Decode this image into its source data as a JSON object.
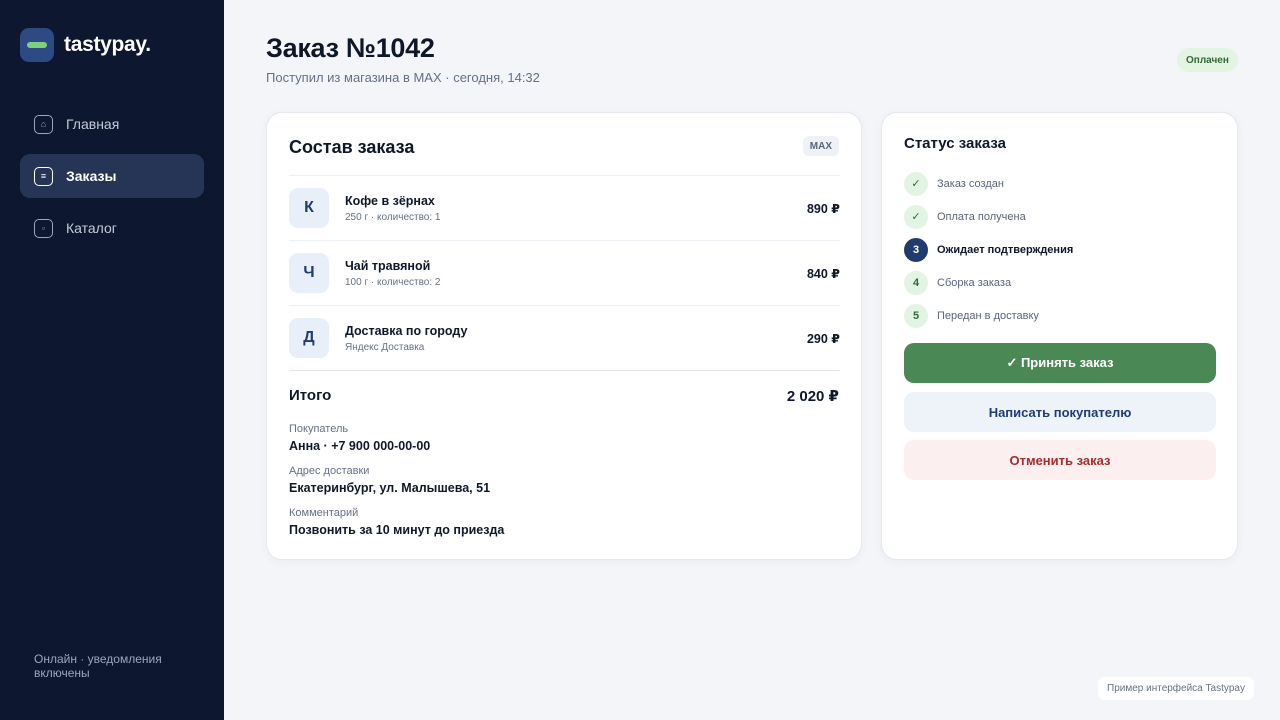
{
  "app": {
    "name": "tastypay."
  },
  "sidebar": {
    "items": [
      {
        "label": "Главная",
        "icon": "home-icon",
        "glyph": "⌂",
        "active": false
      },
      {
        "label": "Заказы",
        "icon": "orders-icon",
        "glyph": "≡",
        "active": true
      },
      {
        "label": "Каталог",
        "icon": "catalog-icon",
        "glyph": "▫",
        "active": false
      }
    ],
    "status": "Онлайн · уведомления включены"
  },
  "header": {
    "title": "Заказ №1042",
    "subtitle": "Поступил из магазина в MAX · сегодня, 14:32",
    "badge": "Оплачен"
  },
  "order": {
    "title": "Состав заказа",
    "source_badge": "MAX",
    "items": [
      {
        "initial": "К",
        "name": "Кофе в зёрнах",
        "meta": "250 г · количество: 1",
        "price": "890 ₽"
      },
      {
        "initial": "Ч",
        "name": "Чай травяной",
        "meta": "100 г · количество: 2",
        "price": "840 ₽"
      },
      {
        "initial": "Д",
        "name": "Доставка по городу",
        "meta": "Яндекс Доставка",
        "price": "290 ₽"
      }
    ],
    "total_label": "Итого",
    "total_value": "2 020 ₽",
    "buyer_label": "Покупатель",
    "buyer_value": "Анна · +7 900 000-00-00",
    "address_label": "Адрес доставки",
    "address_value": "Екатеринбург, ул. Малышева, 51",
    "comment_label": "Комментарий",
    "comment_value": "Позвонить за 10 минут до приезда"
  },
  "status": {
    "title": "Статус заказа",
    "steps": [
      {
        "marker": "✓",
        "label": "Заказ создан",
        "state": "done"
      },
      {
        "marker": "✓",
        "label": "Оплата получена",
        "state": "done"
      },
      {
        "marker": "3",
        "label": "Ожидает подтверждения",
        "state": "current"
      },
      {
        "marker": "4",
        "label": "Сборка заказа",
        "state": "pending"
      },
      {
        "marker": "5",
        "label": "Передан в доставку",
        "state": "pending"
      }
    ],
    "accept_label": "✓ Принять заказ",
    "message_label": "Написать покупателю",
    "cancel_label": "Отменить заказ"
  },
  "footnote": "Пример интерфейса Tastypay",
  "colors": {
    "sidebar_bg": "#0e1730",
    "accent_green": "#4a8856",
    "brand_blue": "#203b6d",
    "danger": "#a52d2d"
  }
}
